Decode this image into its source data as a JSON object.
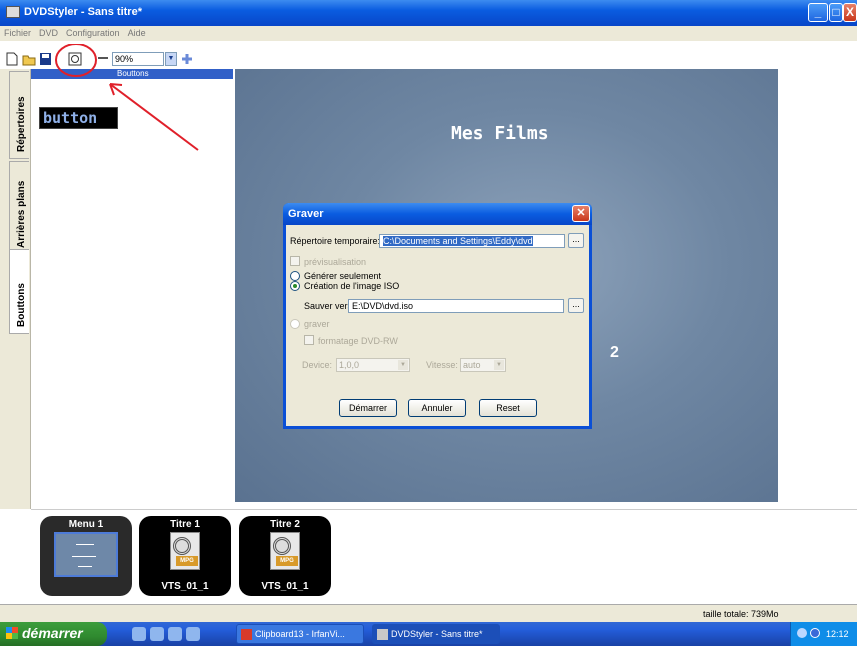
{
  "window": {
    "title": "DVDStyler - Sans titre*",
    "buttons": {
      "minimize": "_",
      "maximize": "□",
      "close": "X"
    }
  },
  "menu": [
    "Fichier",
    "DVD",
    "Configuration",
    "Aide"
  ],
  "toolbar": {
    "zoom": "90%"
  },
  "tabs": [
    "Répertoires",
    "Arrières plans",
    "Bouttons"
  ],
  "left_panel": {
    "header": "Bouttons",
    "sample_button_text": "button"
  },
  "preview": {
    "title": "Mes Films",
    "number": "2"
  },
  "dialog": {
    "title": "Graver",
    "temp_dir_label": "Répertoire temporaire:",
    "temp_dir_value": "C:\\Documents and Settings\\Eddy\\dvd",
    "preview_label": "prévisualisation",
    "generate_only_label": "Générer seulement",
    "iso_label": "Création de l'image ISO",
    "save_to_label": "Sauver vers:",
    "save_to_value": "E:\\DVD\\dvd.iso",
    "burn_label": "graver",
    "format_dvdrw_label": "formatage DVD-RW",
    "device_label": "Device:",
    "device_value": "1,0,0",
    "speed_label": "Vitesse:",
    "speed_value": "auto",
    "browse_label": "...",
    "start_button": "Démarrer",
    "cancel_button": "Annuler",
    "reset_button": "Reset"
  },
  "titleset": [
    {
      "top": "Menu 1",
      "bottom": ""
    },
    {
      "top": "Titre 1",
      "bottom": "VTS_01_1"
    },
    {
      "top": "Titre 2",
      "bottom": "VTS_01_1"
    }
  ],
  "file_badge": "MPG",
  "status": {
    "total": "taille totale: 739Mo"
  },
  "taskbar": {
    "start": "démarrer",
    "tasks": [
      "Clipboard13 - IrfanVi...",
      "DVDStyler - Sans titre*"
    ],
    "clock": "12:12"
  },
  "colors": {
    "titlebar": "#0a5ce0",
    "preview_bg": "#6f87a3",
    "annotation": "#e0202a"
  }
}
